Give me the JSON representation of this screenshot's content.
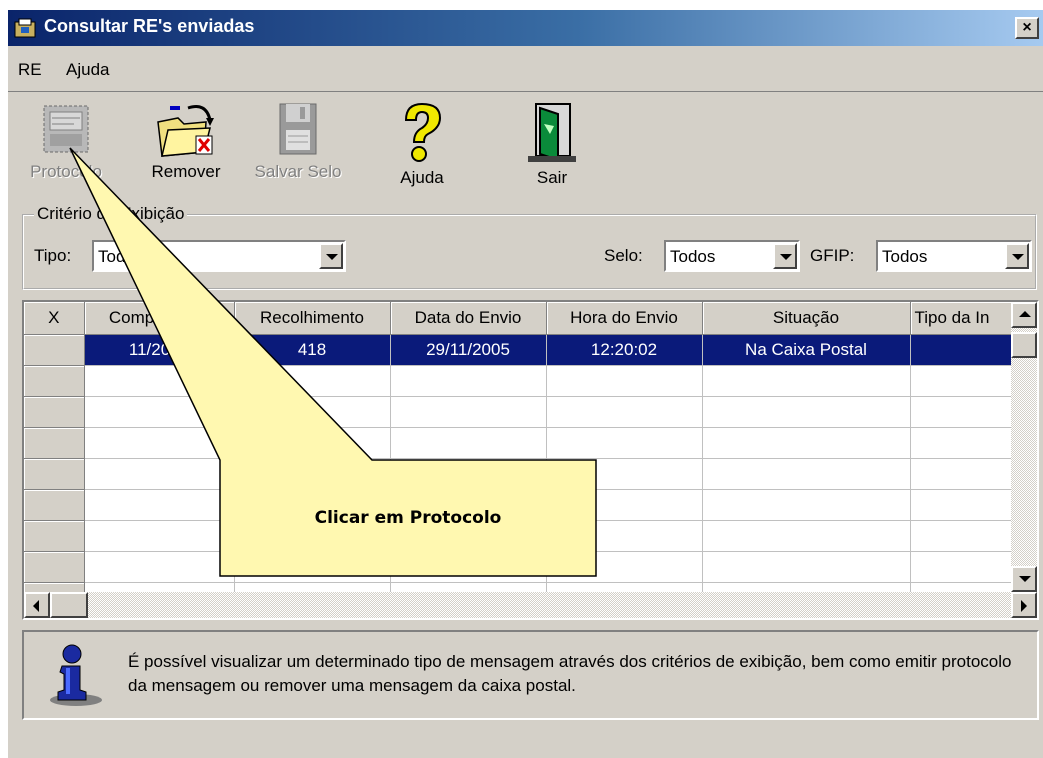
{
  "window": {
    "title": "Consultar RE's enviadas",
    "close_label": "×"
  },
  "menu": {
    "re_label": "RE",
    "help_label": "Ajuda"
  },
  "toolbar": {
    "protocolo": "Protocolo",
    "remover": "Remover",
    "salvar_selo": "Salvar Selo",
    "ajuda": "Ajuda",
    "sair": "Sair"
  },
  "criteria": {
    "legend": "Critério de Exibição",
    "tipo_label": "Tipo:",
    "tipo_value": "Todos",
    "selo_label": "Selo:",
    "selo_value": "Todos",
    "gfip_label": "GFIP:",
    "gfip_value": "Todos"
  },
  "grid": {
    "corner": "X",
    "columns": [
      "Competência",
      "Recolhimento",
      "Data do Envio",
      "Hora do Envio",
      "Situação",
      "Tipo da In"
    ],
    "rows": [
      [
        "11/2005",
        "418",
        "29/11/2005",
        "12:20:02",
        "Na Caixa Postal",
        ""
      ]
    ]
  },
  "info": {
    "message": "É possível visualizar um determinado tipo de mensagem através dos critérios de exibição, bem como emitir protocolo da mensagem ou remover uma mensagem da caixa postal."
  },
  "callout": {
    "text": "Clicar em Protocolo"
  },
  "colors": {
    "title_start": "#0a246a",
    "selection": "#0a1a7a",
    "callout_fill": "#fff8b0",
    "face": "#d4d0c8"
  }
}
